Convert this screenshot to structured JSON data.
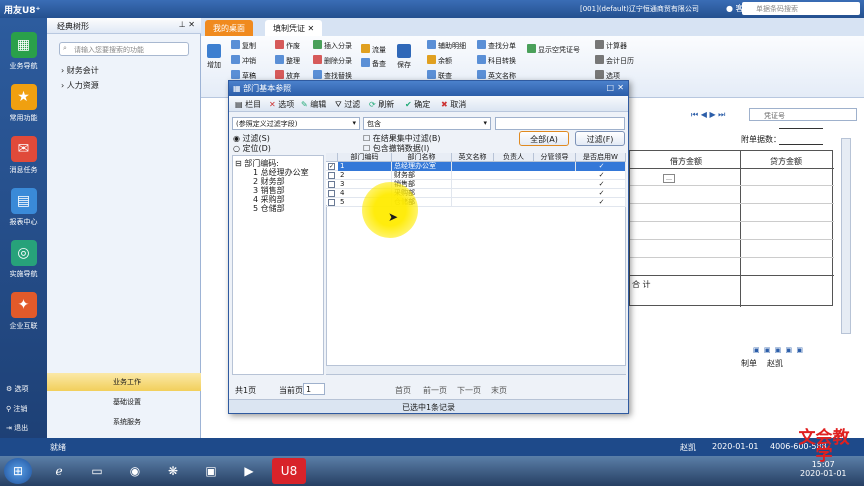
{
  "titlebar": {
    "logo": "用友U8⁺",
    "company": "[001](default)辽宁恒通商贸有限公司",
    "service": "客户服务",
    "search_placeholder": "单据条码搜索"
  },
  "leftnav": {
    "items": [
      "业务导航",
      "常用功能",
      "消息任务",
      "报表中心",
      "实施导航",
      "企业互联"
    ],
    "bottom": [
      "选项",
      "注销",
      "退出"
    ]
  },
  "tree": {
    "header": "经典树形",
    "search_placeholder": "请输入您要搜索的功能",
    "items": [
      "财务会计",
      "人力资源"
    ],
    "tabs": [
      "业务工作",
      "基础设置",
      "系统服务"
    ]
  },
  "tabs": [
    "我的桌面",
    "填制凭证"
  ],
  "ribbon": {
    "add": "增加",
    "save": "保存",
    "items": [
      "复制",
      "作废",
      "插入分录",
      "流量",
      "辅助明细",
      "查找分单",
      "显示空凭证号",
      "计算器",
      "冲销",
      "整理",
      "删除分录",
      "备查",
      "余额",
      "科目转换",
      "会计日历",
      "草稿",
      "放弃",
      "查找替换",
      "联查",
      "英文名称",
      "选项"
    ]
  },
  "voucher": {
    "pager_label": "凭证号",
    "attach_label": "附单据数：",
    "debit": "借方金额",
    "credit": "贷方金额",
    "total": "合 计",
    "maker": "制单",
    "maker_name": "赵凯"
  },
  "dialog": {
    "title": "部门基本参照",
    "toolbar": [
      "栏目",
      "选项",
      "编辑",
      "过滤",
      "刷新",
      "确定",
      "取消"
    ],
    "filter_field": "(参照定义过滤字段)",
    "filter_op": "包含",
    "radio_filter": "过滤(S)",
    "radio_locate": "定位(D)",
    "chk_in_result": "在结果集中过滤(B)",
    "chk_cancel": "包含撤销数据(I)",
    "btn_all": "全部(A)",
    "btn_filter": "过滤(F)",
    "tree_root": "部门编码:",
    "tree_items": [
      "1 总经理办公室",
      "2 财务部",
      "3 销售部",
      "4 采购部",
      "5 仓储部"
    ],
    "columns": [
      "部门编码",
      "部门名称",
      "英文名称",
      "负责人",
      "分管领导",
      "是否启用W"
    ],
    "rows": [
      {
        "code": "1",
        "name": "总经理办公室"
      },
      {
        "code": "2",
        "name": "财务部"
      },
      {
        "code": "3",
        "name": "销售部"
      },
      {
        "code": "4",
        "name": "采购部"
      },
      {
        "code": "5",
        "name": "仓储部"
      }
    ],
    "footer": {
      "total": "共1页",
      "current": "当前页",
      "page": "1",
      "first": "首页",
      "prev": "前一页",
      "next": "下一页",
      "last": "末页"
    },
    "status": "已选中1条记录"
  },
  "statusbar": {
    "left": "就绪",
    "user": "赵凯",
    "date": "2020-01-01",
    "phone": "4006-600-588"
  },
  "taskbar": {
    "time": "15:07",
    "date": "2020-01-01"
  },
  "watermark": "文会教学",
  "colors": {
    "accent": "#2c5ea9",
    "tab_active": "#f08a1e",
    "selected_row": "#3478d8"
  }
}
